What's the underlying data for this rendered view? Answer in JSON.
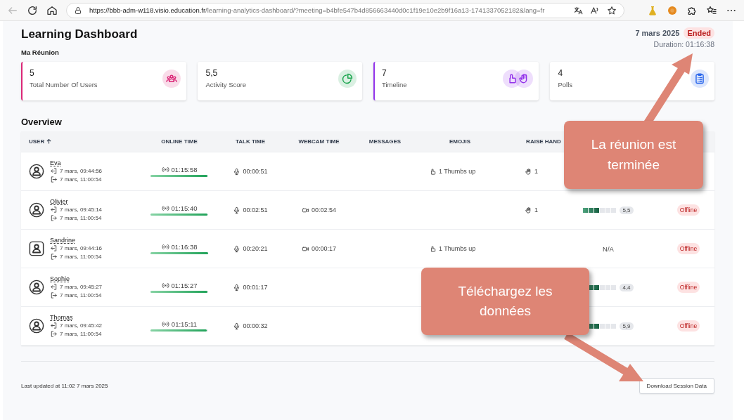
{
  "browser": {
    "url_host": "https://bbb-adm-w118.visio.education.fr",
    "url_path": "/learning-analytics-dashboard/?meeting=b4bfe547b4d856663440d0c1f19e10e2b9f16a13-1741337052182&lang=fr"
  },
  "header": {
    "title": "Learning Dashboard",
    "meeting": "Ma Réunion",
    "date": "7 mars 2025",
    "status": "Ended",
    "duration": "Duration: 01:16:38"
  },
  "cards": [
    {
      "value": "5",
      "label": "Total Number Of Users",
      "kind": "users",
      "highlighted": true
    },
    {
      "value": "5,5",
      "label": "Activity Score",
      "kind": "score",
      "highlighted": false
    },
    {
      "value": "7",
      "label": "Timeline",
      "kind": "timeline",
      "highlighted": true
    },
    {
      "value": "4",
      "label": "Polls",
      "kind": "polls",
      "highlighted": false
    }
  ],
  "overview": {
    "title": "Overview",
    "columns": [
      "USER",
      "ONLINE TIME",
      "TALK TIME",
      "WEBCAM TIME",
      "MESSAGES",
      "EMOJIS",
      "RAISE HAND"
    ],
    "rows": [
      {
        "kind": "viewer",
        "name": "Eva",
        "joined": "7 mars, 09:44:56",
        "left": "7 mars, 11:00:54",
        "online": "01:15:58",
        "online_level": {
          "level": 0.99
        },
        "talk": "00:00:51",
        "emojis": "1 Thumbs up",
        "raise_hand": "1"
      },
      {
        "kind": "viewer",
        "name": "Olivier",
        "joined": "7 mars, 09:45:14",
        "left": "7 mars, 11:00:54",
        "online": "01:15:40",
        "online_level": {
          "level": 0.99
        },
        "talk": "00:02:51",
        "webcam": "00:02:54",
        "raise_hand": "1",
        "activity": {
          "level": 0.5
        },
        "score": "5,5",
        "status": "Offline"
      },
      {
        "kind": "moderator",
        "name": "Sandrine",
        "joined": "7 mars, 09:44:16",
        "left": "7 mars, 11:00:54",
        "online": "01:16:38",
        "online_level": {
          "level": 1
        },
        "talk": "00:20:21",
        "webcam": "00:00:17",
        "emojis": "1 Thumbs up",
        "activity_text": "N/A",
        "status": "Offline"
      },
      {
        "kind": "viewer",
        "name": "Sophie",
        "joined": "7 mars, 09:45:27",
        "left": "7 mars, 11:00:54",
        "online": "01:15:27",
        "online_level": {
          "level": 0.99
        },
        "talk": "00:01:17",
        "activity": {
          "level": 0.5
        },
        "score": "4,4",
        "status": "Offline"
      },
      {
        "kind": "viewer",
        "name": "Thomas",
        "joined": "7 mars, 09:45:42",
        "left": "7 mars, 11:00:54",
        "online": "01:15:11",
        "online_level": {
          "level": 0.98
        },
        "talk": "00:00:32",
        "activity": {
          "level": 0.5
        },
        "score": "5,9",
        "status": "Offline"
      }
    ]
  },
  "footer": {
    "updated": "Last updated at 11:02 7 mars 2025",
    "download": "Download Session Data"
  },
  "callouts": [
    {
      "text": "La réunion est terminée"
    },
    {
      "text": "Téléchargez les données"
    }
  ]
}
